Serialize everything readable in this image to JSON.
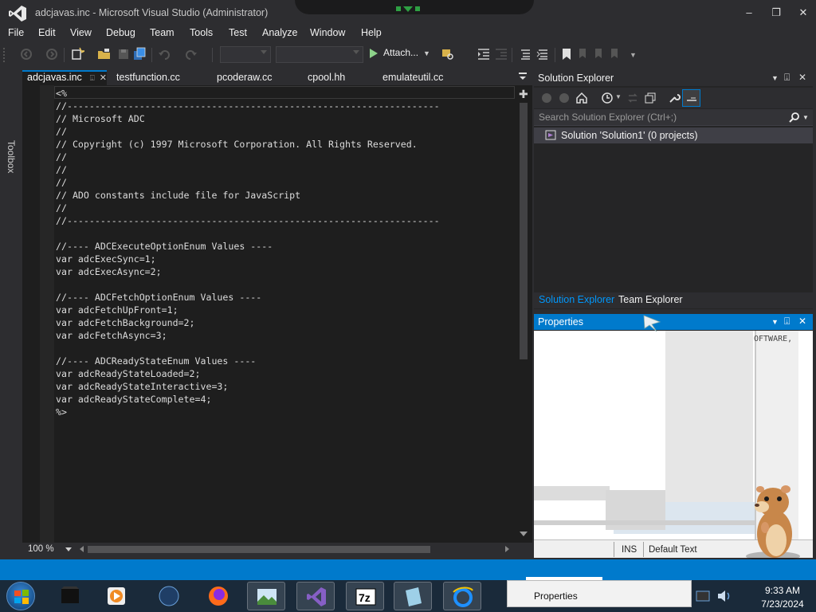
{
  "window": {
    "title": "adcjavas.inc - Microsoft Visual Studio (Administrator)"
  },
  "menu": [
    "File",
    "Edit",
    "View",
    "Debug",
    "Team",
    "Tools",
    "Test",
    "Analyze",
    "Window",
    "Help"
  ],
  "toolbar": {
    "attach_label": "Attach...",
    "config_value": "",
    "platform_value": ""
  },
  "toolbox": {
    "label": "Toolbox"
  },
  "tabs": [
    {
      "label": "adcjavas.inc",
      "active": true
    },
    {
      "label": "testfunction.cc",
      "active": false
    },
    {
      "label": "pcoderaw.cc",
      "active": false
    },
    {
      "label": "cpool.hh",
      "active": false
    },
    {
      "label": "emulateutil.cc",
      "active": false
    }
  ],
  "editor": {
    "lines": [
      "<%",
      "//-------------------------------------------------------------------",
      "// Microsoft ADC",
      "//",
      "// Copyright (c) 1997 Microsoft Corporation. All Rights Reserved.",
      "//",
      "//",
      "//",
      "// ADO constants include file for JavaScript",
      "//",
      "//-------------------------------------------------------------------",
      "",
      "//---- ADCExecuteOptionEnum Values ----",
      "var adcExecSync=1;",
      "var adcExecAsync=2;",
      "",
      "//---- ADCFetchOptionEnum Values ----",
      "var adcFetchUpFront=1;",
      "var adcFetchBackground=2;",
      "var adcFetchAsync=3;",
      "",
      "//---- ADCReadyStateEnum Values ----",
      "var adcReadyStateLoaded=2;",
      "var adcReadyStateInteractive=3;",
      "var adcReadyStateComplete=4;",
      "%>"
    ],
    "zoom": "100 %"
  },
  "solution_explorer": {
    "title": "Solution Explorer",
    "search_placeholder": "Search Solution Explorer (Ctrl+;)",
    "tree_item": "Solution 'Solution1' (0 projects)",
    "bottom_tabs": [
      "Solution Explorer",
      "Team Explorer"
    ]
  },
  "properties": {
    "title": "Properties",
    "ghost_text": "OFTWARE,",
    "status_ins": "INS",
    "status_text": "Default Text"
  },
  "taskbar": {
    "popup_label": "Properties",
    "time": "9:33 AM",
    "date": "7/23/2024"
  },
  "colors": {
    "accent": "#007acc",
    "editor_bg": "#1e1e1e",
    "chrome_bg": "#2d2d30",
    "comment": "#dcdcdc"
  }
}
